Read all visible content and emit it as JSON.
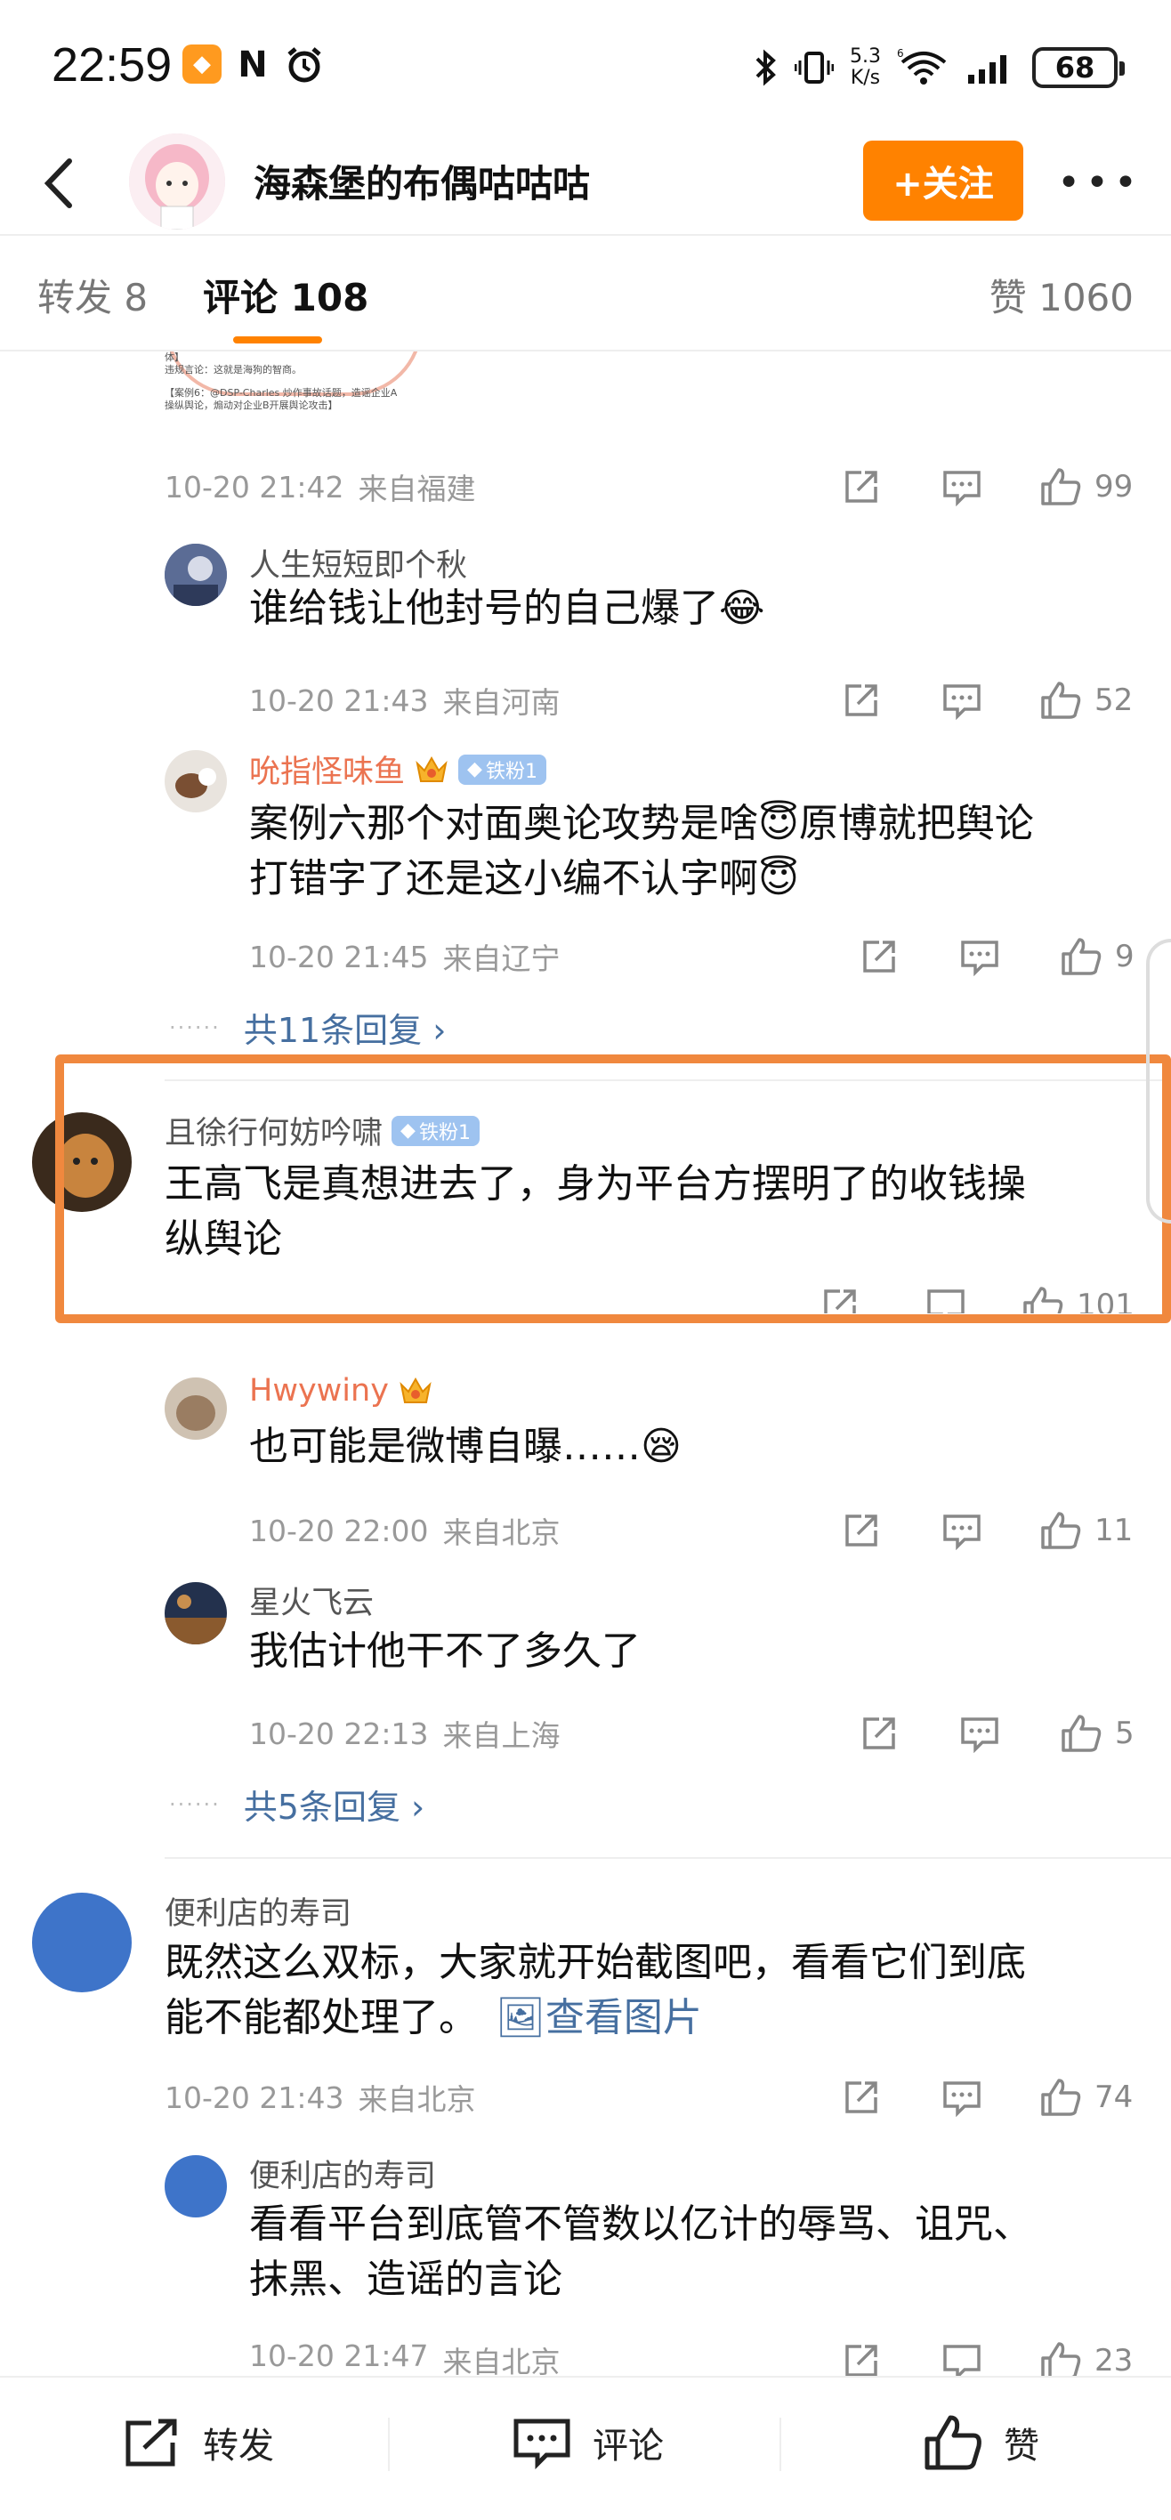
{
  "status_bar": {
    "time": "22:59",
    "net_speed_value": "5.3",
    "net_speed_unit": "K/s",
    "battery": "68"
  },
  "header": {
    "title": "海森堡的布偶咕咕咕",
    "follow_label": "+关注",
    "more_label": "•••"
  },
  "tabs": [
    {
      "label": "转发 8"
    },
    {
      "label": "评论 108"
    },
    {
      "label": "赞 1060"
    }
  ],
  "cropped_image": {
    "line1": "体】",
    "line2": "违规言论：这就是海狗的智商。",
    "line3": "【案例6：@DSP-Charles 炒作事故话题，造谣企业A",
    "line4": "操纵舆论，煽动对企业B开展舆论攻击】"
  },
  "comments": {
    "c0": {
      "date": "10-20 21:42",
      "location": "来自福建",
      "likes": "99"
    },
    "r1": {
      "user": "人生短短即个秋",
      "text": "谁给钱让他封号的自己爆了😂",
      "date": "10-20 21:43",
      "location": "来自河南",
      "likes": "52"
    },
    "r2": {
      "user": "吮指怪味鱼",
      "badge": "铁粉1",
      "text_line1": "案例六那个对面奥论攻势是啥😇原博就把舆论",
      "text_line2": "打错字了还是这小编不认字啊😇",
      "date": "10-20 21:45",
      "location": "来自辽宁",
      "likes": "9"
    },
    "more1": "共11条回复 ›",
    "c3": {
      "user": "且徐行何妨吟啸",
      "badge": "铁粉1",
      "text_line1": "王高飞是真想进去了，身为平台方摆明了的收钱操",
      "text_line2": "纵舆论",
      "likes": "101"
    },
    "r4": {
      "user": "Hwywiny",
      "text": "也可能是微博自曝……😪",
      "date": "10-20 22:00",
      "location": "来自北京",
      "likes": "11"
    },
    "r5": {
      "user": "星火飞云",
      "text": "我估计他干不了多久了",
      "date": "10-20 22:13",
      "location": "来自上海",
      "likes": "5"
    },
    "more2": "共5条回复 ›",
    "c6": {
      "user": "便利店的寿司",
      "text_line1": "既然这么双标，大家就开始截图吧，看看它们到底",
      "text_line2_a": "能不能都处理了。",
      "image_link": "🖼查看图片",
      "date": "10-20 21:43",
      "location": "来自北京",
      "likes": "74"
    },
    "r7": {
      "user": "便利店的寿司",
      "text_line1": "看看平台到底管不管数以亿计的辱骂、诅咒、",
      "text_line2": "抹黑、造谣的言论",
      "date": "10-20 21:47",
      "location": "来自北京",
      "likes": "23"
    }
  },
  "bottom_bar": {
    "repost": "转发",
    "comment": "评论",
    "like": "赞"
  },
  "colors": {
    "accent": "#ff8200",
    "link": "#466fa0",
    "username_vip": "#eb7350",
    "highlight_box": "#f0883e"
  }
}
